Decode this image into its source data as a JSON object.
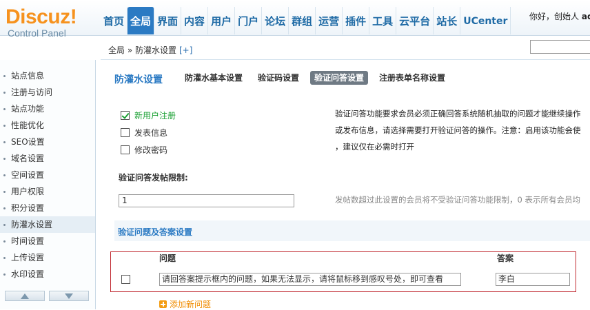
{
  "logo": {
    "main": "Discuz!",
    "sub": "Control Panel"
  },
  "nav": [
    "首页",
    "全局",
    "界面",
    "内容",
    "用户",
    "门户",
    "论坛",
    "群组",
    "运营",
    "插件",
    "工具",
    "云平台",
    "站长",
    "UCenter"
  ],
  "nav_active": "全局",
  "greeting": {
    "prefix": "你好，创始人",
    "user": "ad"
  },
  "breadcrumb": {
    "text": "全局 » 防灌水设置",
    "plus": "[+]"
  },
  "sidebar": {
    "items": [
      "站点信息",
      "注册与访问",
      "站点功能",
      "性能优化",
      "SEO设置",
      "域名设置",
      "空间设置",
      "用户权限",
      "积分设置",
      "防灌水设置",
      "时间设置",
      "上传设置",
      "水印设置"
    ],
    "active": "防灌水设置"
  },
  "main": {
    "title": "防灌水设置",
    "tabs": [
      "防灌水基本设置",
      "验证码设置",
      "验证问答设置",
      "注册表单名称设置"
    ],
    "active_tab": "验证问答设置",
    "options": [
      {
        "label": "新用户注册",
        "checked": true
      },
      {
        "label": "发表信息",
        "checked": false
      },
      {
        "label": "修改密码",
        "checked": false
      }
    ],
    "desc_lines": [
      "验证问答功能要求会员必须正确回答系统随机抽取的问题才能继续操作",
      "或发布信息，请选择需要打开验证问答的操作。注意：启用该功能会使",
      "，建议仅在必需时打开"
    ],
    "limit_label": "验证问答发帖限制:",
    "limit_value": "1",
    "limit_tip": "发帖数超过此设置的会员将不受验证问答功能限制，0 表示所有会员均",
    "section_title": "验证问题及答案设置",
    "qa": {
      "col_question": "问题",
      "col_answer": "答案",
      "question": "请回答案提示框内的问题，如果无法显示，请将鼠标移到感叹号处，即可查看",
      "answer": "李白"
    },
    "add_question": "添加新问题"
  },
  "colors": {
    "accent": "#2b7ac3",
    "logo": "#f6921e",
    "highlight_border": "#c0262d",
    "green": "#1aa033"
  }
}
